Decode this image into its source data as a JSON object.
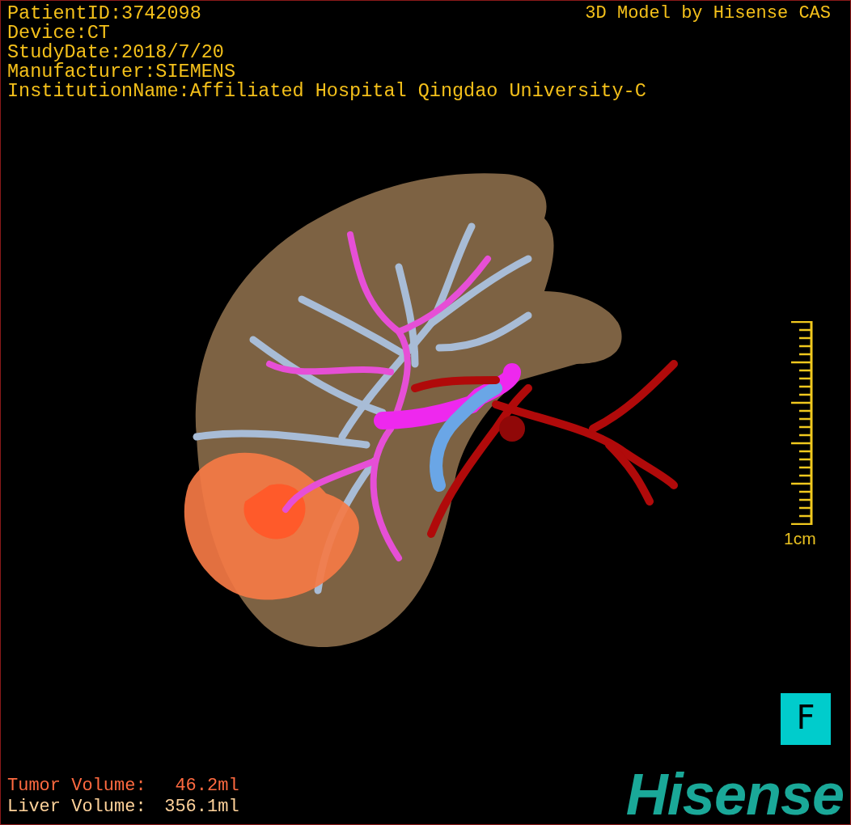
{
  "study_info": [
    "PatientID:3742098",
    "Device:CT",
    "StudyDate:2018/7/20",
    "Manufacturer:SIEMENS",
    "InstitutionName:Affiliated Hospital Qingdao University-C"
  ],
  "model_credit": "3D Model by Hisense CAS",
  "scale_bar": {
    "label": "1cm"
  },
  "orientation_marker": "F",
  "volumes": [
    {
      "label": "Tumor Volume:",
      "value": "46.2ml",
      "color": "#ff6a40"
    },
    {
      "label": "Liver Volume:",
      "value": "356.1ml",
      "color": "#ffd29a"
    }
  ],
  "logo": "Hisense"
}
